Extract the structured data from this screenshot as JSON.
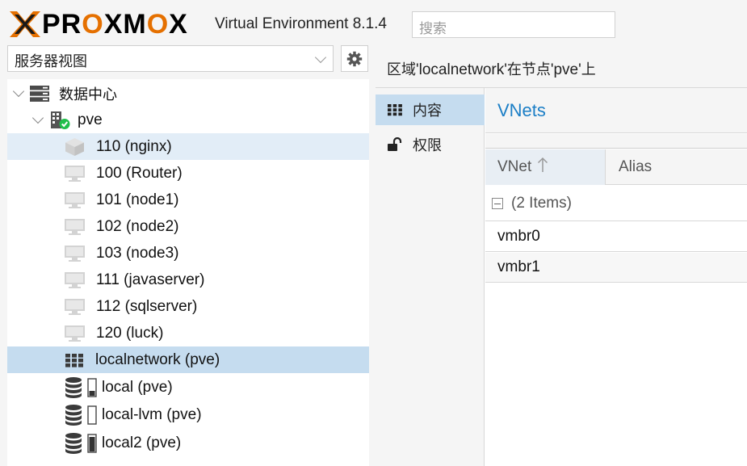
{
  "header": {
    "brand_part1": "PR",
    "brand_o1": "O",
    "brand_part2": "XM",
    "brand_o2": "O",
    "brand_x": "X",
    "product": "Virtual Environment 8.1.4",
    "search_placeholder": "搜索"
  },
  "view_selector": {
    "value": "服务器视图"
  },
  "tree": {
    "datacenter": "数据中心",
    "node": "pve",
    "items": [
      {
        "label": "110 (nginx)",
        "icon": "container-icon"
      },
      {
        "label": "100 (Router)",
        "icon": "vm-icon"
      },
      {
        "label": "101 (node1)",
        "icon": "vm-icon"
      },
      {
        "label": "102 (node2)",
        "icon": "vm-icon"
      },
      {
        "label": "103 (node3)",
        "icon": "vm-icon"
      },
      {
        "label": "111 (javaserver)",
        "icon": "vm-icon"
      },
      {
        "label": "112 (sqlserver)",
        "icon": "vm-icon"
      },
      {
        "label": "120 (luck)",
        "icon": "vm-icon"
      },
      {
        "label": "localnetwork (pve)",
        "icon": "sdn-zone-icon"
      },
      {
        "label": "local (pve)",
        "icon": "storage-icon",
        "usage": 0.3
      },
      {
        "label": "local-lvm (pve)",
        "icon": "storage-icon",
        "usage": 0.0
      },
      {
        "label": "local2 (pve)",
        "icon": "storage-icon",
        "usage": 0.9
      }
    ]
  },
  "content": {
    "title_prefix": "区域",
    "title_zone": "'localnetwork'",
    "title_mid": "在节点",
    "title_node": "'pve'",
    "title_suffix": "上",
    "tabs": [
      {
        "label": "内容",
        "icon": "grid-icon"
      },
      {
        "label": "权限",
        "icon": "unlock-icon"
      }
    ],
    "panel_title": "VNets",
    "columns": {
      "vnet": "VNet",
      "alias": "Alias"
    },
    "group_label": "(2 Items)",
    "rows": [
      "vmbr0",
      "vmbr1"
    ]
  },
  "colors": {
    "accent_orange": "#e57000",
    "selection_blue": "#c5dcef",
    "link_blue": "#1b7ec6",
    "status_green": "#21bf4b"
  }
}
